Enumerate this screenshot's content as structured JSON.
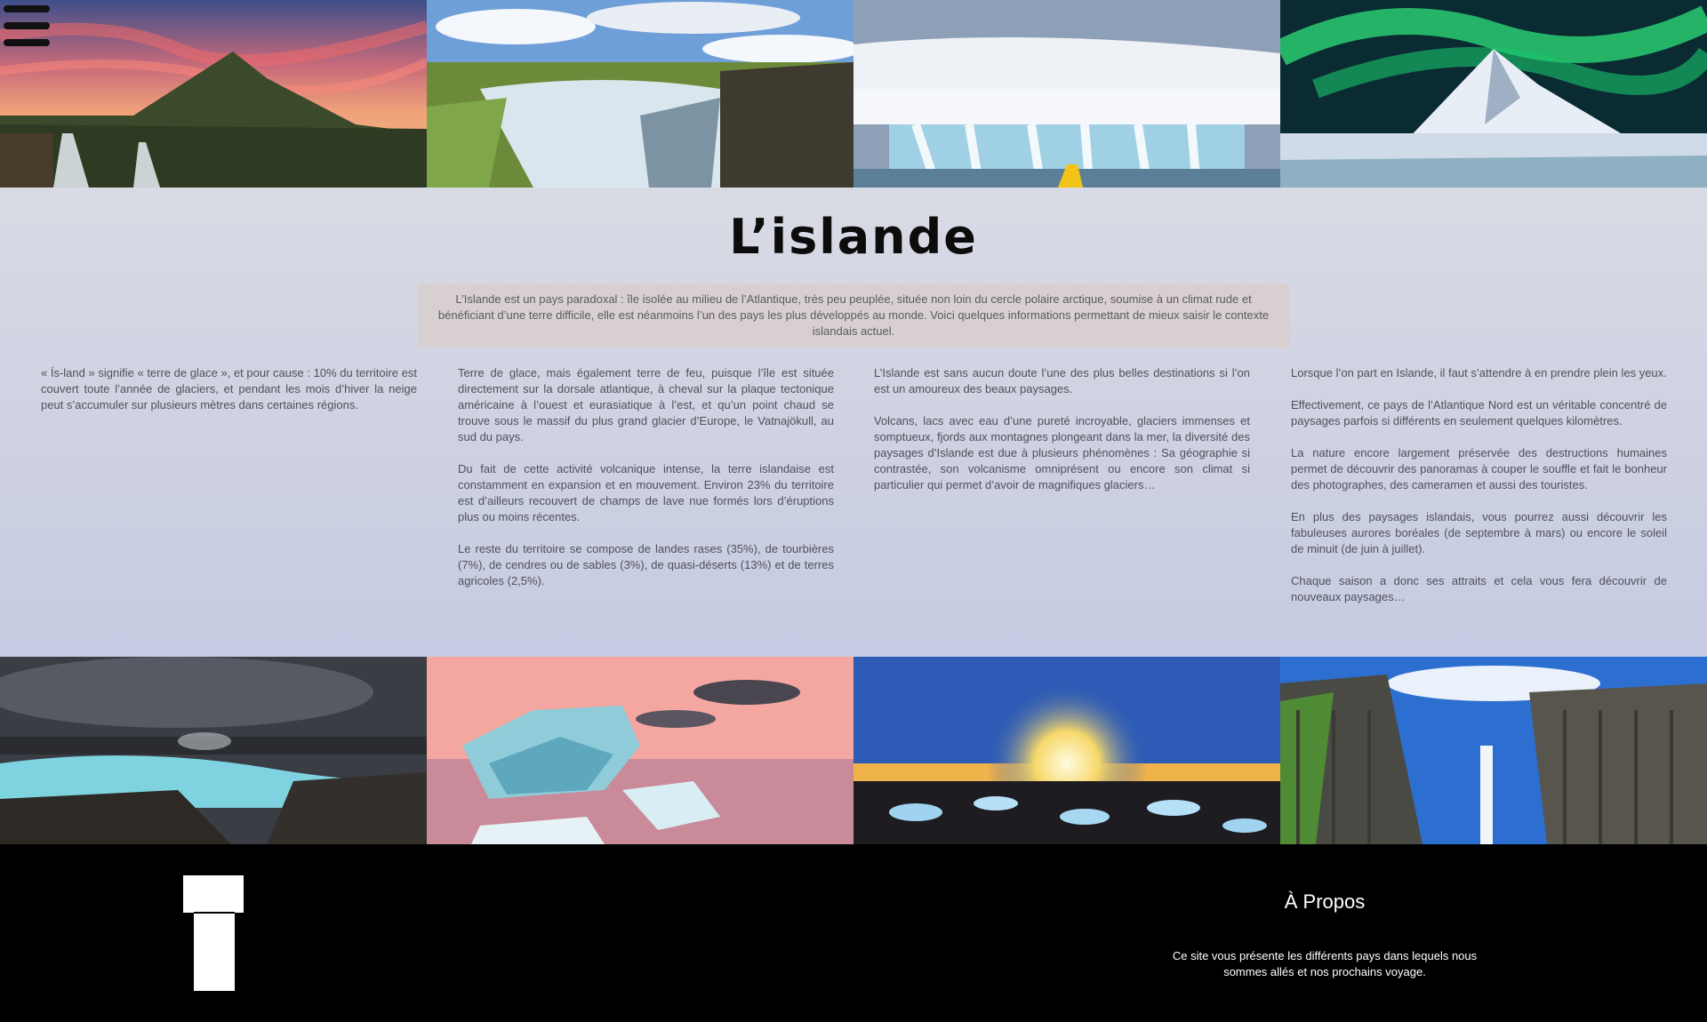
{
  "menu": {
    "icon": "hamburger-menu-icon"
  },
  "gallery_top": [
    {
      "name": "mountain-sunset-photo"
    },
    {
      "name": "waterfall-canyon-photo"
    },
    {
      "name": "frozen-waterfall-photo"
    },
    {
      "name": "northern-lights-mountain-photo"
    }
  ],
  "page": {
    "title": "L’islande",
    "intro": "L’Islande est un pays paradoxal : île isolée au milieu de l’Atlantique, très peu peuplée, située non loin du cercle polaire arctique, soumise à un climat rude et bénéficiant d’une terre difficile, elle est néanmoins l’un des pays les plus développés au monde. Voici quelques informations permettant de mieux saisir le contexte islandais actuel."
  },
  "columns": [
    {
      "paragraphs": [
        "« Ís-land » signifie « terre de glace », et pour cause : 10% du territoire est couvert toute l’année de glaciers, et pendant les mois d’hiver la neige peut s’accumuler sur plusieurs mètres dans certaines régions."
      ]
    },
    {
      "paragraphs": [
        "Terre de glace, mais également terre de feu, puisque l’île est située directement sur la dorsale atlantique, à cheval sur la plaque tectonique américaine à l’ouest et eurasiatique à l’est, et qu’un point chaud se trouve sous le massif du plus grand glacier d’Europe, le Vatnajökull, au sud du pays.",
        "Du fait de cette activité volcanique intense, la terre islandaise est constamment en expansion et en mouvement. Environ 23% du territoire est d’ailleurs recouvert de champs de lave nue formés lors d’éruptions plus ou moins récentes.",
        "Le reste du territoire se compose de landes rases (35%), de tourbières (7%), de cendres ou de sables (3%), de quasi-déserts (13%) et de terres agricoles (2,5%)."
      ]
    },
    {
      "paragraphs": [
        "L’Islande est sans aucun doute l’une des plus belles destinations si l’on est un amoureux des beaux paysages.",
        "Volcans, lacs avec eau d’une pureté incroyable, glaciers immenses et somptueux, fjords aux montagnes plongeant dans la mer, la diversité des paysages d’Islande est due à plusieurs phénomènes : Sa géographie si contrastée, son volcanisme omniprésent ou encore son climat si particulier qui permet d’avoir de magnifiques glaciers…"
      ]
    },
    {
      "paragraphs": [
        "Lorsque l’on part en Islande, il faut s’attendre à en prendre plein les yeux.",
        "Effectivement, ce pays de l’Atlantique Nord est un véritable concentré de paysages parfois si différents en seulement quelques kilomètres.",
        "La nature encore largement préservée des destructions humaines permet de découvrir des panoramas à couper le souffle et fait le bonheur des photographes, des cameramen et aussi des touristes.",
        "En plus des paysages islandais, vous pourrez aussi découvrir les fabuleuses aurores boréales (de septembre à mars) ou encore le soleil de minuit (de juin à juillet).",
        "Chaque saison a donc ses attraits et cela vous fera découvrir de nouveaux paysages…"
      ]
    }
  ],
  "gallery_bottom": [
    {
      "name": "blue-lagoon-photo"
    },
    {
      "name": "iceberg-sunset-photo"
    },
    {
      "name": "black-beach-sunrise-photo"
    },
    {
      "name": "basalt-waterfall-photo"
    }
  ],
  "footer": {
    "logo_icon": "t-logo-icon",
    "about_title": "À Propos",
    "about_text": "Ce site vous présente les différents pays dans lequels nous sommes allés et nos prochains voyage."
  },
  "colors": {
    "main_bg": "#d3d6e3",
    "intro_bg": "#d8cfd0",
    "text": "#4f5058",
    "footer_bg": "#000000"
  }
}
